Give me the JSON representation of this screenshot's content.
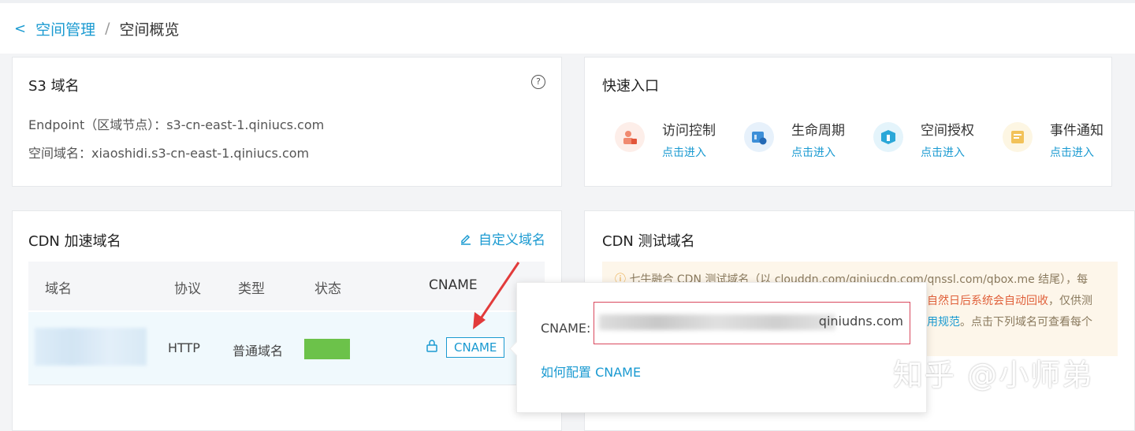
{
  "breadcrumb": {
    "back": "<",
    "parent": "空间管理",
    "separator": "/",
    "current": "空间概览"
  },
  "s3": {
    "title": "S3 域名",
    "help": "?",
    "endpoint": "Endpoint（区域节点）：s3-cn-east-1.qiniucs.com",
    "space_domain": "空间域名：xiaoshidi.s3-cn-east-1.qiniucs.com"
  },
  "quick_entry": {
    "title": "快速入口",
    "items": [
      {
        "label": "访问控制",
        "link": "点击进入",
        "color": "#f08a70",
        "bg": "#fdeee9",
        "icon": "access-control-icon"
      },
      {
        "label": "生命周期",
        "link": "点击进入",
        "color": "#3d8fd8",
        "bg": "#e7f1fb",
        "icon": "lifecycle-icon"
      },
      {
        "label": "空间授权",
        "link": "点击进入",
        "color": "#2aa7d8",
        "bg": "#e4f4fb",
        "icon": "authorization-icon"
      },
      {
        "label": "事件通知",
        "link": "点击进入",
        "color": "#f2c259",
        "bg": "#fdf6e3",
        "icon": "event-notify-icon"
      }
    ]
  },
  "cdn": {
    "title": "CDN 加速域名",
    "custom_domain": "自定义域名",
    "columns": [
      "域名",
      "协议",
      "类型",
      "状态",
      "CNAME"
    ],
    "row": {
      "protocol": "HTTP",
      "type": "普通域名",
      "cname_button": "CNAME"
    }
  },
  "cdn_test": {
    "title": "CDN 测试域名",
    "notice_line1": "七牛融合 CDN 测试域名（以 clouddn.com/qiniucdn.com/qnssl.com/qbox.me 结尾），每",
    "notice_line2_red": "自然日后系统会自动回收",
    "notice_line2_rest": "，仅供测",
    "notice_line3_blue": "用规范",
    "notice_line3_rest": "。点击下列域名可查看每个"
  },
  "popover": {
    "cname_label": "CNAME:",
    "cname_suffix": "qiniudns.com",
    "howto": "如何配置 CNAME"
  },
  "watermark": "知乎 @小师弟"
}
